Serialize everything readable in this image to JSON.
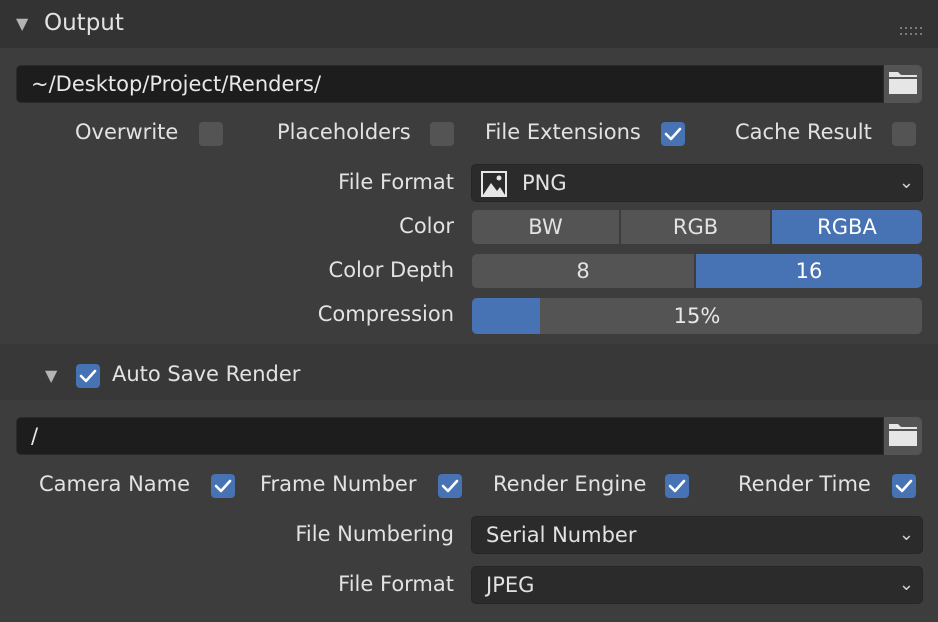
{
  "panel": {
    "title": "Output",
    "output_path": "~/Desktop/Project/Renders/",
    "options": {
      "overwrite": {
        "label": "Overwrite",
        "checked": false
      },
      "placeholders": {
        "label": "Placeholders",
        "checked": false
      },
      "file_extensions": {
        "label": "File Extensions",
        "checked": true
      },
      "cache_result": {
        "label": "Cache Result",
        "checked": false
      }
    },
    "file_format": {
      "label": "File Format",
      "value": "PNG"
    },
    "color": {
      "label": "Color",
      "options": [
        "BW",
        "RGB",
        "RGBA"
      ],
      "selected": "RGBA"
    },
    "color_depth": {
      "label": "Color Depth",
      "options": [
        "8",
        "16"
      ],
      "selected": "16"
    },
    "compression": {
      "label": "Compression",
      "value": "15%",
      "fraction": 0.15
    }
  },
  "auto_save": {
    "label": "Auto Save Render",
    "checked": true,
    "path": "/",
    "options": {
      "camera_name": {
        "label": "Camera Name",
        "checked": true
      },
      "frame_number": {
        "label": "Frame Number",
        "checked": true
      },
      "render_engine": {
        "label": "Render Engine",
        "checked": true
      },
      "render_time": {
        "label": "Render Time",
        "checked": true
      }
    },
    "file_numbering": {
      "label": "File Numbering",
      "value": "Serial Number"
    },
    "file_format": {
      "label": "File Format",
      "value": "JPEG"
    }
  },
  "colors": {
    "accent": "#4772b3",
    "panel_bg": "#3d3d3d",
    "field_bg": "#1d1d1d"
  }
}
